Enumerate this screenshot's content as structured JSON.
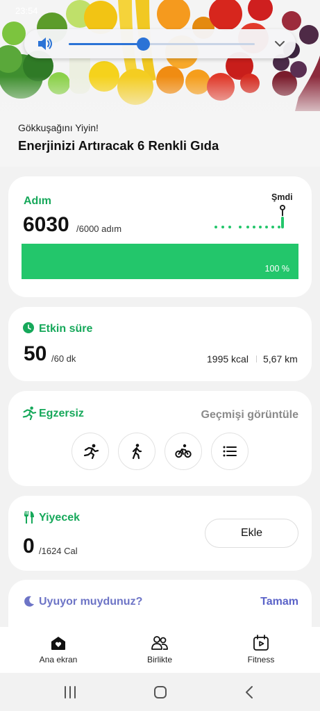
{
  "status_bar": {
    "time": "23:54"
  },
  "hero": {
    "subtitle": "Gökkuşağını Yiyin!",
    "title": "Enerjinizi Artıracak 6 Renkli Gıda"
  },
  "volume": {
    "level": 0.4,
    "icon": "speaker-icon",
    "expand_icon": "chevron-down-icon"
  },
  "steps_card": {
    "label": "Adım",
    "value": "6030",
    "goal": "/6000 adım",
    "now_label": "Şmdi",
    "progress_percent": 100,
    "progress_text": "100 %",
    "color": "#23c66b"
  },
  "active_card": {
    "label": "Etkin süre",
    "value": "50",
    "goal": "/60 dk",
    "kcal": "1995 kcal",
    "distance": "5,67 km"
  },
  "exercise_card": {
    "label": "Egzersiz",
    "history_link": "Geçmişi görüntüle",
    "buttons": [
      "running-icon",
      "walking-icon",
      "cycling-icon",
      "list-icon"
    ]
  },
  "food_card": {
    "label": "Yiyecek",
    "value": "0",
    "goal": "/1624 Cal",
    "add_label": "Ekle"
  },
  "sleep_card": {
    "label": "Uyuyor muydunuz?",
    "ok_label": "Tamam"
  },
  "bottom_nav": {
    "items": [
      {
        "label": "Ana ekran",
        "icon": "home-icon"
      },
      {
        "label": "Birlikte",
        "icon": "people-icon"
      },
      {
        "label": "Fitness",
        "icon": "fitness-icon"
      }
    ]
  },
  "colors": {
    "accent_green": "#16a85a",
    "sleep_purple": "#6d74c6",
    "volume_blue": "#2b73d6"
  }
}
